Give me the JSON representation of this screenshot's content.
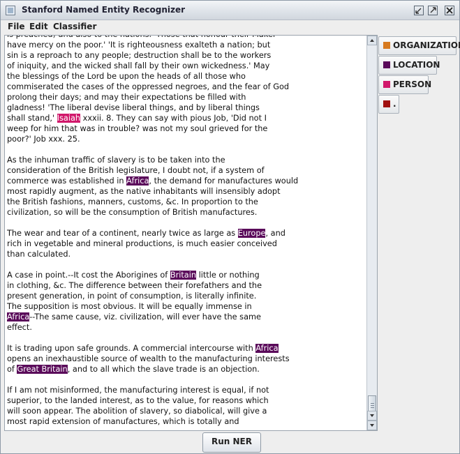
{
  "window": {
    "title": "Stanford Named Entity Recognizer"
  },
  "menu": [
    "File",
    "Edit",
    "Classifier"
  ],
  "entity_types": [
    {
      "label": "ORGANIZATION",
      "color": "#d77a1f"
    },
    {
      "label": "LOCATION",
      "color": "#5a0a5a"
    },
    {
      "label": "PERSON",
      "color": "#d1186b"
    },
    {
      "label": ".",
      "color": "#a01010"
    }
  ],
  "document": {
    "paragraphs": [
      [
        [
          [
            "is preached) and also to the nations.' Those that honour their Maker",
            ""
          ]
        ],
        [
          [
            "have mercy on the poor.' 'It is righteousness exalteth a nation; but",
            ""
          ]
        ],
        [
          [
            "sin is a reproach to any people; destruction shall be to the workers",
            ""
          ]
        ],
        [
          [
            "of iniquity, and the wicked shall fall by their own wickedness.' May",
            ""
          ]
        ],
        [
          [
            "the blessings of the Lord be upon the heads of all those who",
            ""
          ]
        ],
        [
          [
            "commiserated the cases of the oppressed negroes, and the fear of God",
            ""
          ]
        ],
        [
          [
            "prolong their days; and may their expectations be filled with",
            ""
          ]
        ],
        [
          [
            "gladness! 'The liberal devise liberal things, and by liberal things",
            ""
          ]
        ],
        [
          [
            "shall stand,' ",
            ""
          ],
          [
            "Isaiah",
            "per"
          ],
          [
            " xxxii. 8. They can say with pious Job, 'Did not I",
            ""
          ]
        ],
        [
          [
            "weep for him that was in trouble? was not my soul grieved for the",
            ""
          ]
        ],
        [
          [
            "poor?' Job xxx. 25.",
            ""
          ]
        ]
      ],
      [
        [
          [
            "As the inhuman traffic of slavery is to be taken into the",
            ""
          ]
        ],
        [
          [
            "consideration of the British legislature, I doubt not, if a system of",
            ""
          ]
        ],
        [
          [
            "commerce was established in ",
            ""
          ],
          [
            "Africa",
            "loc"
          ],
          [
            ", the demand for manufactures would",
            ""
          ]
        ],
        [
          [
            "most rapidly augment, as the native inhabitants will insensibly adopt",
            ""
          ]
        ],
        [
          [
            "the British fashions, manners, customs, &c. In proportion to the",
            ""
          ]
        ],
        [
          [
            "civilization, so will be the consumption of British manufactures.",
            ""
          ]
        ]
      ],
      [
        [
          [
            "The wear and tear of a continent, nearly twice as large as ",
            ""
          ],
          [
            "Europe",
            "loc"
          ],
          [
            ", and",
            ""
          ]
        ],
        [
          [
            "rich in vegetable and mineral productions, is much easier conceived",
            ""
          ]
        ],
        [
          [
            "than calculated.",
            ""
          ]
        ]
      ],
      [
        [
          [
            "A case in point.--It cost the Aborigines of ",
            ""
          ],
          [
            "Britain",
            "loc"
          ],
          [
            " little or nothing",
            ""
          ]
        ],
        [
          [
            "in clothing, &c. The difference between their forefathers and the",
            ""
          ]
        ],
        [
          [
            "present generation, in point of consumption, is literally infinite.",
            ""
          ]
        ],
        [
          [
            "The supposition is most obvious. It will be equally immense in",
            ""
          ]
        ],
        [
          [
            "Africa",
            "loc"
          ],
          [
            "--The same cause, viz. civilization, will ever have the same",
            ""
          ]
        ],
        [
          [
            "effect.",
            ""
          ]
        ]
      ],
      [
        [
          [
            "It is trading upon safe grounds. A commercial intercourse with ",
            ""
          ],
          [
            "Africa",
            "loc"
          ]
        ],
        [
          [
            "opens an inexhaustible source of wealth to the manufacturing interests",
            ""
          ]
        ],
        [
          [
            "of ",
            ""
          ],
          [
            "Great Britain",
            "loc"
          ],
          [
            ", and to all which the slave trade is an objection.",
            ""
          ]
        ]
      ],
      [
        [
          [
            "If I am not misinformed, the manufacturing interest is equal, if not",
            ""
          ]
        ],
        [
          [
            "superior, to the landed interest, as to the value, for reasons which",
            ""
          ]
        ],
        [
          [
            "will soon appear. The abolition of slavery, so diabolical, will give a",
            ""
          ]
        ],
        [
          [
            "most rapid extension of manufactures, which is totally and",
            ""
          ]
        ]
      ]
    ]
  },
  "run_button": {
    "label": "Run NER"
  }
}
